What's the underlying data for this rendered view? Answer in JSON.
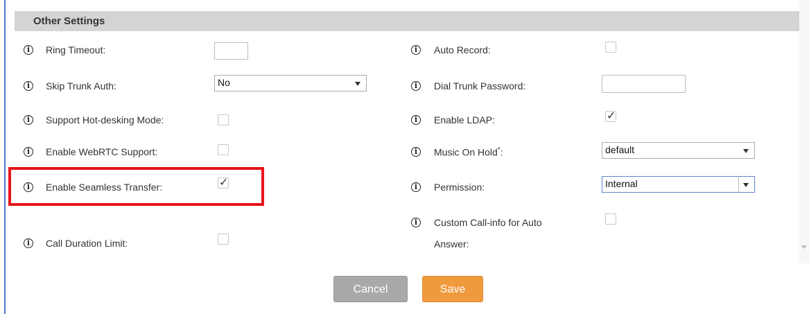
{
  "section": {
    "title": "Other Settings"
  },
  "left": {
    "ring_timeout": {
      "label": "Ring Timeout:",
      "value": ""
    },
    "skip_trunk_auth": {
      "label": "Skip Trunk Auth:",
      "value": "No"
    },
    "hot_desking": {
      "label": "Support Hot-desking Mode:",
      "checked": false
    },
    "webrtc": {
      "label": "Enable WebRTC Support:",
      "checked": false
    },
    "seamless_transfer": {
      "label": "Enable Seamless Transfer:",
      "checked": true
    },
    "call_duration_limit": {
      "label": "Call Duration Limit:",
      "checked": false
    }
  },
  "right": {
    "auto_record": {
      "label": "Auto Record:",
      "checked": false
    },
    "dial_trunk_password": {
      "label": "Dial Trunk Password:",
      "value": ""
    },
    "enable_ldap": {
      "label": "Enable LDAP:",
      "checked": true
    },
    "music_on_hold": {
      "label": "Music On Hold",
      "required_mark": "*",
      "colon": ":",
      "value": "default"
    },
    "permission": {
      "label": "Permission:",
      "value": "Internal"
    },
    "custom_call_info": {
      "label_line1": "Custom Call-info for Auto",
      "label_line2": "Answer:",
      "checked": false
    }
  },
  "icons": {
    "info": "info-circle-icon",
    "checkmark": "✓"
  },
  "buttons": {
    "cancel": "Cancel",
    "save": "Save"
  },
  "colors": {
    "highlight": "#e8141a",
    "save": "#f09a3e",
    "cancel": "#a9a9a9",
    "header": "#d4d4d4"
  }
}
